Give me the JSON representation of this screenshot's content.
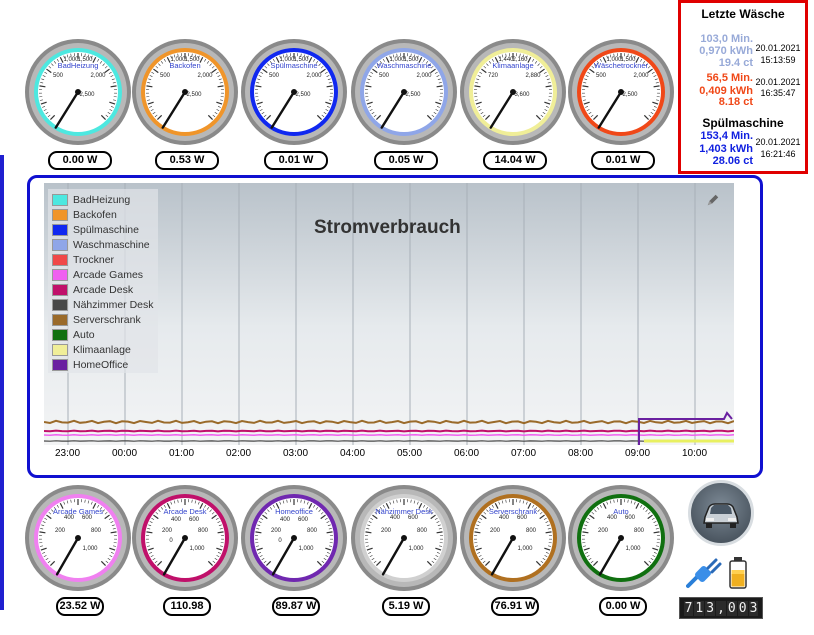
{
  "top_gauges": [
    {
      "name": "BadHeizung",
      "ring": "#4de8e0",
      "ticks": [
        "1,000",
        "1,500",
        "500",
        "2,000",
        "2,500"
      ],
      "power": "0.00 W"
    },
    {
      "name": "Backofen",
      "ring": "#f0952a",
      "ticks": [
        "1,000",
        "1,500",
        "500",
        "2,000",
        "2,500"
      ],
      "power": "0.53 W"
    },
    {
      "name": "Spülmaschine",
      "ring": "#1028f0",
      "ticks": [
        "1,000",
        "1,500",
        "500",
        "2,000",
        "2,500"
      ],
      "power": "0.01 W"
    },
    {
      "name": "Waschmaschine",
      "ring": "#8fa6e8",
      "ticks": [
        "1,000",
        "1,500",
        "500",
        "2,000",
        "2,500"
      ],
      "power": "0.05 W"
    },
    {
      "name": "Klimaanlage",
      "ring": "#f0ee98",
      "ticks": [
        "1,440",
        "2,160",
        "720",
        "2,880",
        "3,600"
      ],
      "power": "14.04 W"
    },
    {
      "name": "Wäschetrockner",
      "ring": "#f04818",
      "ticks": [
        "1,000",
        "1,500",
        "500",
        "2,000",
        "2,500"
      ],
      "power": "0.01 W"
    }
  ],
  "bottom_gauges": [
    {
      "name": "Arcade Games",
      "ring": "#f080f0",
      "ticks": [
        "400",
        "600",
        "200",
        "800",
        "1,000"
      ],
      "power": "23.52 W"
    },
    {
      "name": "Arcade Desk",
      "ring": "#c0106a",
      "ticks": [
        "400",
        "600",
        "200",
        "800",
        "0",
        "1,000"
      ],
      "power": "110.98"
    },
    {
      "name": "Homeoffice",
      "ring": "#7028b0",
      "ticks": [
        "400",
        "600",
        "200",
        "800",
        "0",
        "1,000"
      ],
      "power": "89.87 W"
    },
    {
      "name": "Nähzimmer Desk",
      "ring": "#d0d0d0",
      "ticks": [
        "400",
        "600",
        "200",
        "800",
        "1,000"
      ],
      "power": "5.19 W"
    },
    {
      "name": "Serverschrank",
      "ring": "#b07020",
      "ticks": [
        "400",
        "600",
        "200",
        "800",
        "1,000"
      ],
      "power": "76.91 W"
    },
    {
      "name": "Auto",
      "ring": "#107010",
      "ticks": [
        "400",
        "600",
        "200",
        "800",
        "1,000"
      ],
      "power": "0.00 W"
    }
  ],
  "panel": {
    "title1": "Letzte Wäsche",
    "title2": "Spülmaschine",
    "entries": [
      {
        "l1": "103,0 Min.",
        "l2": "0,970 kWh",
        "l3": "19.4 ct",
        "date": "20.01.2021",
        "time": "15:13:59",
        "color": "#98aad8"
      },
      {
        "l1": "56,5 Min.",
        "l2": "0,409 kWh",
        "l3": "8.18 ct",
        "date": "20.01.2021",
        "time": "16:35:47",
        "color": "#f04818"
      },
      {
        "l1": "153,4 Min.",
        "l2": "1,403 kWh",
        "l3": "28.06 ct",
        "date": "20.01.2021",
        "time": "16:21:46",
        "color": "#1020e0"
      }
    ]
  },
  "chart_data": {
    "type": "line",
    "title": "Stromverbrauch",
    "x_ticks": [
      "23:00",
      "00:00",
      "01:00",
      "02:00",
      "03:00",
      "04:00",
      "05:00",
      "06:00",
      "07:00",
      "08:00",
      "09:00",
      "10:00"
    ],
    "legend": [
      {
        "name": "BadHeizung",
        "color": "#4de8e0"
      },
      {
        "name": "Backofen",
        "color": "#f0952a"
      },
      {
        "name": "Spülmaschine",
        "color": "#1028f0"
      },
      {
        "name": "Waschmaschine",
        "color": "#8fa6e8"
      },
      {
        "name": "Trockner",
        "color": "#f04848"
      },
      {
        "name": "Arcade Games",
        "color": "#f060f0"
      },
      {
        "name": "Arcade Desk",
        "color": "#c0106a"
      },
      {
        "name": "Nähzimmer Desk",
        "color": "#484848"
      },
      {
        "name": "Serverschrank",
        "color": "#9a6a2a"
      },
      {
        "name": "Auto",
        "color": "#107010"
      },
      {
        "name": "Klimaanlage",
        "color": "#f0ee98"
      },
      {
        "name": "HomeOffice",
        "color": "#6a20a0"
      }
    ]
  },
  "counter": "713,003",
  "icons": {
    "car": "car-icon",
    "plug": "plug-icon",
    "battery": "battery-icon",
    "edit": "pencil-icon"
  }
}
